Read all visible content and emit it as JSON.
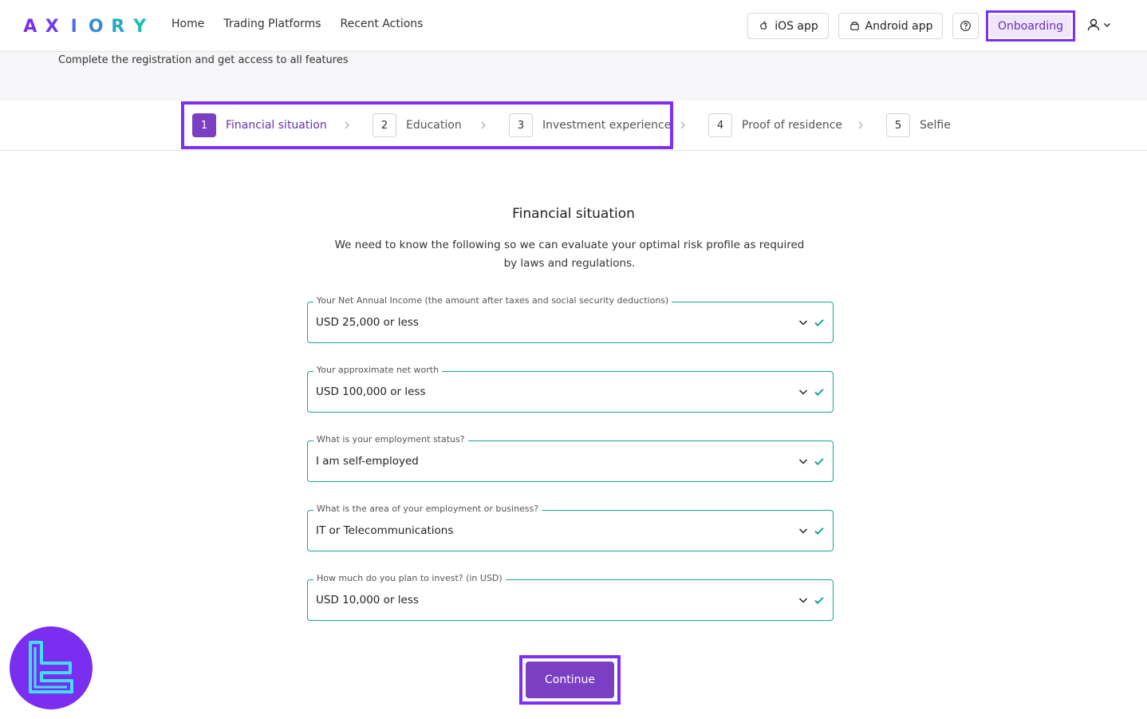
{
  "header": {
    "logo_letters": [
      "A",
      "X",
      "I",
      "O",
      "R",
      "Y"
    ],
    "logo_colors": [
      "#7a2ff0",
      "#6f3bec",
      "#4d6fe0",
      "#3a8ad8",
      "#25a8c8",
      "#1bbfb2"
    ],
    "nav": [
      "Home",
      "Trading Platforms",
      "Recent Actions"
    ],
    "ios_label": "iOS app",
    "android_label": "Android app",
    "onboarding_label": "Onboarding"
  },
  "banner": {
    "text": "Complete the registration and get access to all features"
  },
  "steps": [
    {
      "num": "1",
      "label": "Financial situation",
      "active": true
    },
    {
      "num": "2",
      "label": "Education",
      "active": false
    },
    {
      "num": "3",
      "label": "Investment experience",
      "active": false
    },
    {
      "num": "4",
      "label": "Proof of residence",
      "active": false
    },
    {
      "num": "5",
      "label": "Selfie",
      "active": false
    }
  ],
  "form": {
    "title": "Financial situation",
    "description": "We need to know the following so we can evaluate your optimal risk profile as required by laws and regulations.",
    "fields": [
      {
        "label": "Your Net Annual Income (the amount after taxes and social security deductions)",
        "value": "USD 25,000 or less"
      },
      {
        "label": "Your approximate net worth",
        "value": "USD 100,000 or less"
      },
      {
        "label": "What is your employment status?",
        "value": "I am self-employed"
      },
      {
        "label": "What is the area of your employment or business?",
        "value": "IT or Telecommunications"
      },
      {
        "label": "How much do you plan to invest? (in USD)",
        "value": "USD 10,000 or less"
      }
    ],
    "continue_label": "Continue"
  },
  "colors": {
    "accent": "#7b3fc4",
    "highlight": "#7b2ff7",
    "field_border": "#1aa39a",
    "check": "#1aa39a"
  }
}
